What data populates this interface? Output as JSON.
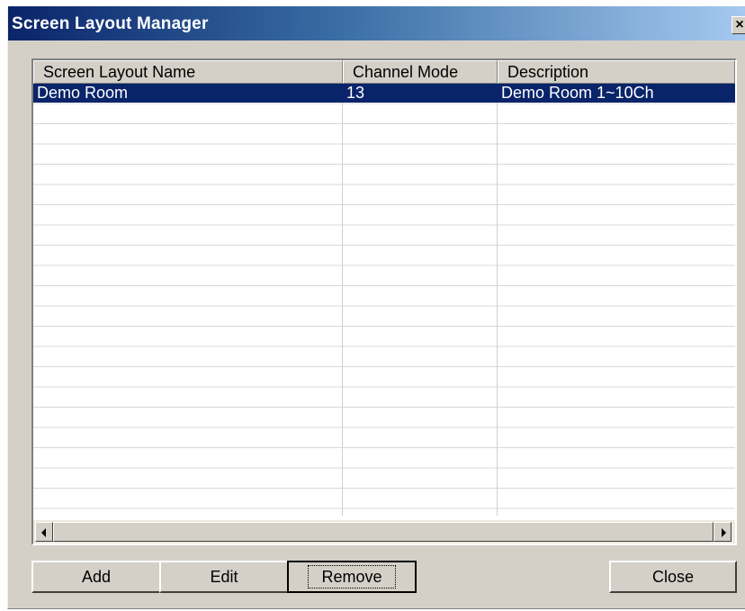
{
  "window": {
    "title": "Screen Layout Manager",
    "close_glyph": "×"
  },
  "list": {
    "columns": [
      "Screen Layout Name",
      "Channel Mode",
      "Description"
    ],
    "rows": [
      {
        "name": "Demo Room",
        "channel_mode": "13",
        "description": "Demo Room 1~10Ch",
        "selected": true
      }
    ]
  },
  "scrollbar": {
    "left_icon": "arrow-left-icon",
    "right_icon": "arrow-right-icon"
  },
  "buttons": {
    "add": "Add",
    "edit": "Edit",
    "remove": "Remove",
    "close": "Close"
  },
  "colors": {
    "title_gradient_start": "#0a246a",
    "title_gradient_end": "#a6caf0",
    "selection": "#0a246a",
    "dialog_face": "#d4d0c8"
  }
}
